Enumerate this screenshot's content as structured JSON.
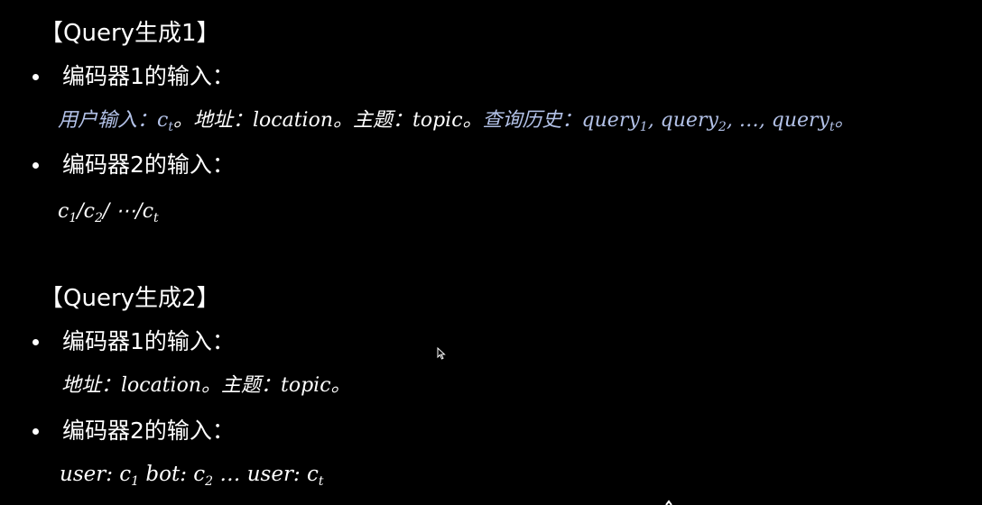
{
  "section1": {
    "heading": "【Query生成1】",
    "bullet1": "编码器1的输入：",
    "line1": {
      "p1": "用户输入：",
      "p2": "c",
      "p2_sub": "t",
      "p3": "。地址：location。主题：topic。",
      "p4": "查询历史：",
      "p5a": "query",
      "p5a_sub": "1",
      "p5b": ", query",
      "p5b_sub": "2",
      "p5c": ", …, query",
      "p5c_sub": "t",
      "p6": "。"
    },
    "bullet2": "编码器2的输入：",
    "line2": {
      "a": "c",
      "a_sub": "1",
      "b": "/c",
      "b_sub": "2",
      "c": "/ ⋯/c",
      "c_sub": "t"
    }
  },
  "section2": {
    "heading": "【Query生成2】",
    "bullet1": "编码器1的输入：",
    "line1": "地址：location。主题：topic。",
    "bullet2": "编码器2的输入：",
    "line2": {
      "a": "user: c",
      "a_sub": "1",
      "b": " bot: c",
      "b_sub": "2",
      "c": " … user: c",
      "c_sub": "t"
    }
  },
  "colors": {
    "background": "#000000",
    "text": "#ffffff",
    "highlight": "#b3c2e8"
  },
  "icons": {
    "cursor": "mouse-pointer-icon"
  }
}
